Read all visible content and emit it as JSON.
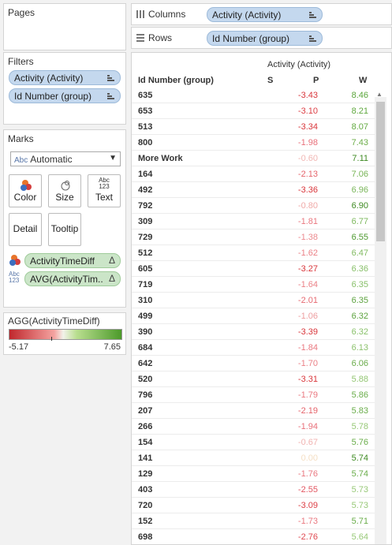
{
  "pages": {
    "title": "Pages"
  },
  "shelves": {
    "columns_label": "Columns",
    "columns_pill": "Activity (Activity)",
    "rows_label": "Rows",
    "rows_pill": "Id Number (group)"
  },
  "filters": {
    "title": "Filters",
    "items": [
      {
        "label": "Activity (Activity)"
      },
      {
        "label": "Id Number (group)"
      }
    ]
  },
  "marks": {
    "title": "Marks",
    "type_value": "Automatic",
    "type_icon": "Abc",
    "buttons": {
      "color": "Color",
      "size": "Size",
      "text": "Text",
      "text_icon_top": "Abc",
      "text_icon_bottom": "123",
      "detail": "Detail",
      "tooltip": "Tooltip"
    },
    "fields": [
      {
        "label": "ActivityTimeDiff",
        "delta": "Δ"
      },
      {
        "label": "AVG(ActivityTim..",
        "delta": "Δ",
        "icon_top": "Abc",
        "icon_bottom": "123"
      }
    ]
  },
  "legend": {
    "title": "AGG(ActivityTimeDiff)",
    "min": "-5.17",
    "max": "7.65"
  },
  "table": {
    "column_group_header": "Activity (Activity)",
    "row_header": "Id Number (group)",
    "col_s": "S",
    "col_p": "P",
    "col_w": "W",
    "rows": [
      {
        "id": "635",
        "p": "-3.43",
        "w": "8.46",
        "pc": "#d9363b",
        "wc": "#5aa53a"
      },
      {
        "id": "653",
        "p": "-3.10",
        "w": "8.21",
        "pc": "#dd4046",
        "wc": "#5fa83e"
      },
      {
        "id": "513",
        "p": "-3.34",
        "w": "8.07",
        "pc": "#d9363b",
        "wc": "#63aa41"
      },
      {
        "id": "800",
        "p": "-1.98",
        "w": "7.43",
        "pc": "#e8707a",
        "wc": "#6dae4a"
      },
      {
        "id": "More Work",
        "p": "-0.60",
        "w": "7.11",
        "pc": "#f1b7b4",
        "wc": "#3e8a22"
      },
      {
        "id": "164",
        "p": "-2.13",
        "w": "7.06",
        "pc": "#e5646b",
        "wc": "#77b455"
      },
      {
        "id": "492",
        "p": "-3.36",
        "w": "6.96",
        "pc": "#d9363b",
        "wc": "#7ab65a"
      },
      {
        "id": "792",
        "p": "-0.80",
        "w": "6.90",
        "pc": "#f0aaa8",
        "wc": "#3e8a22"
      },
      {
        "id": "309",
        "p": "-1.81",
        "w": "6.77",
        "pc": "#ea7880",
        "wc": "#7db85d"
      },
      {
        "id": "729",
        "p": "-1.38",
        "w": "6.55",
        "pc": "#ec8a8f",
        "wc": "#4e9a30"
      },
      {
        "id": "512",
        "p": "-1.62",
        "w": "6.47",
        "pc": "#eb8187",
        "wc": "#82bb62"
      },
      {
        "id": "605",
        "p": "-3.27",
        "w": "6.36",
        "pc": "#d9363b",
        "wc": "#87bf68"
      },
      {
        "id": "719",
        "p": "-1.64",
        "w": "6.35",
        "pc": "#eb8187",
        "wc": "#87bf68"
      },
      {
        "id": "310",
        "p": "-2.01",
        "w": "6.35",
        "pc": "#e66a72",
        "wc": "#5da33f"
      },
      {
        "id": "499",
        "p": "-1.06",
        "w": "6.32",
        "pc": "#ee9ea0",
        "wc": "#5da33f"
      },
      {
        "id": "390",
        "p": "-3.39",
        "w": "6.32",
        "pc": "#d9363b",
        "wc": "#8ac16b"
      },
      {
        "id": "684",
        "p": "-1.84",
        "w": "6.13",
        "pc": "#ea7880",
        "wc": "#8cc26d"
      },
      {
        "id": "642",
        "p": "-1.70",
        "w": "6.06",
        "pc": "#eb8187",
        "wc": "#68ab48"
      },
      {
        "id": "520",
        "p": "-3.31",
        "w": "5.88",
        "pc": "#d9363b",
        "wc": "#93c673"
      },
      {
        "id": "796",
        "p": "-1.79",
        "w": "5.86",
        "pc": "#ea7880",
        "wc": "#6aad4a"
      },
      {
        "id": "207",
        "p": "-2.19",
        "w": "5.83",
        "pc": "#e5646b",
        "wc": "#6aad4a"
      },
      {
        "id": "266",
        "p": "-1.94",
        "w": "5.78",
        "pc": "#e8707a",
        "wc": "#96c876"
      },
      {
        "id": "154",
        "p": "-0.67",
        "w": "5.76",
        "pc": "#f1b3b1",
        "wc": "#6aad4a"
      },
      {
        "id": "141",
        "p": "0.00",
        "w": "5.74",
        "pc": "#f5dfc4",
        "wc": "#3e8a22"
      },
      {
        "id": "129",
        "p": "-1.76",
        "w": "5.74",
        "pc": "#ea7880",
        "wc": "#6aad4a"
      },
      {
        "id": "403",
        "p": "-2.55",
        "w": "5.73",
        "pc": "#e25560",
        "wc": "#98c978"
      },
      {
        "id": "720",
        "p": "-3.09",
        "w": "5.73",
        "pc": "#dd4046",
        "wc": "#98c978"
      },
      {
        "id": "152",
        "p": "-1.73",
        "w": "5.71",
        "pc": "#ea7880",
        "wc": "#6aad4a"
      },
      {
        "id": "698",
        "p": "-2.76",
        "w": "5.64",
        "pc": "#e04a52",
        "wc": "#98c978"
      }
    ]
  }
}
